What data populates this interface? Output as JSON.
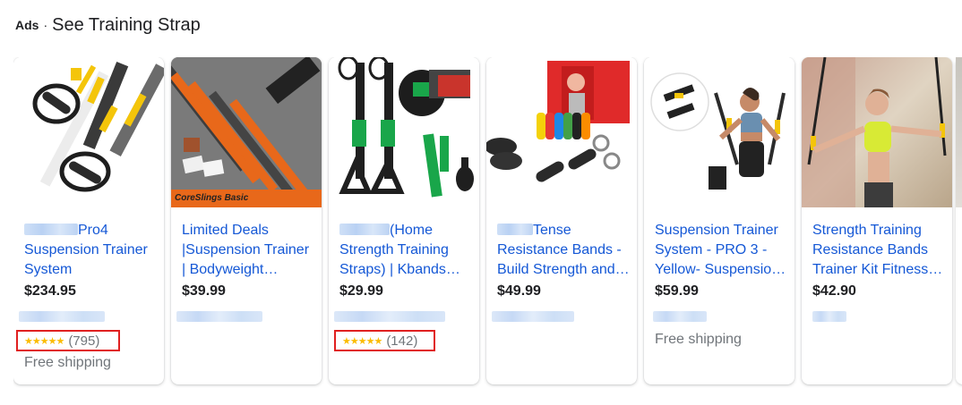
{
  "header": {
    "ads_label": "Ads",
    "separator": "·",
    "title": "See Training Strap"
  },
  "cards": [
    {
      "title_suffix": "Pro4",
      "title_rest": "Suspension Trainer System",
      "price": "$234.95",
      "stars": "★★★★★",
      "rating_count": "(795)",
      "shipping": "Free shipping"
    },
    {
      "title": "Limited Deals |Suspension Trainer | Bodyweight Resistance Training Kit",
      "price": "$39.99",
      "image_brand_text": "CoreSlings Basic"
    },
    {
      "title_suffix": "(Home",
      "title_rest": "Strength Training Straps) | Kbands Training",
      "price": "$29.99",
      "stars": "★★★★★",
      "rating_count": "(142)"
    },
    {
      "title_suffix": "Tense",
      "title_rest": "Resistance Bands - Build Strength and Tone",
      "price": "$49.99"
    },
    {
      "title": "Suspension Trainer System - PRO 3 - Yellow- Suspension Training Straps",
      "price": "$59.99",
      "shipping": "Free shipping"
    },
    {
      "title": "Strength Training Resistance Bands Trainer Kit Fitness Straps",
      "price": "$42.90"
    }
  ],
  "colors": {
    "link_blue": "#1558d6",
    "star_yellow": "#fbbc04",
    "highlight_red": "#e02020",
    "muted_gray": "#70757a"
  }
}
